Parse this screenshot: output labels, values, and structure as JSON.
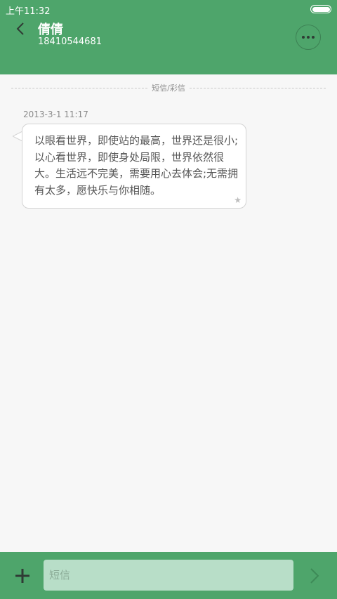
{
  "status_bar": {
    "time": "上午11:32"
  },
  "header": {
    "contact_name": "倩倩",
    "contact_number": "18410544681"
  },
  "conversation": {
    "divider_label": "短信/彩信",
    "messages": [
      {
        "timestamp": "2013-3-1 11:17",
        "text": "以眼看世界，即使站的最高，世界还是很小;以心看世界，即使身处局限，世界依然很大。生活远不完美，需要用心去体会;无需拥有太多，愿快乐与你相随。"
      }
    ]
  },
  "composer": {
    "placeholder": "短信"
  },
  "icons": {
    "back": "chevron-left-icon",
    "more": "more-dots-icon",
    "star": "star-icon",
    "add": "plus-icon",
    "send": "send-chevron-icon",
    "battery": "battery-icon"
  },
  "colors": {
    "accent": "#4ea56b",
    "input_bg": "#b8dec8",
    "page_bg": "#f7f7f7"
  }
}
